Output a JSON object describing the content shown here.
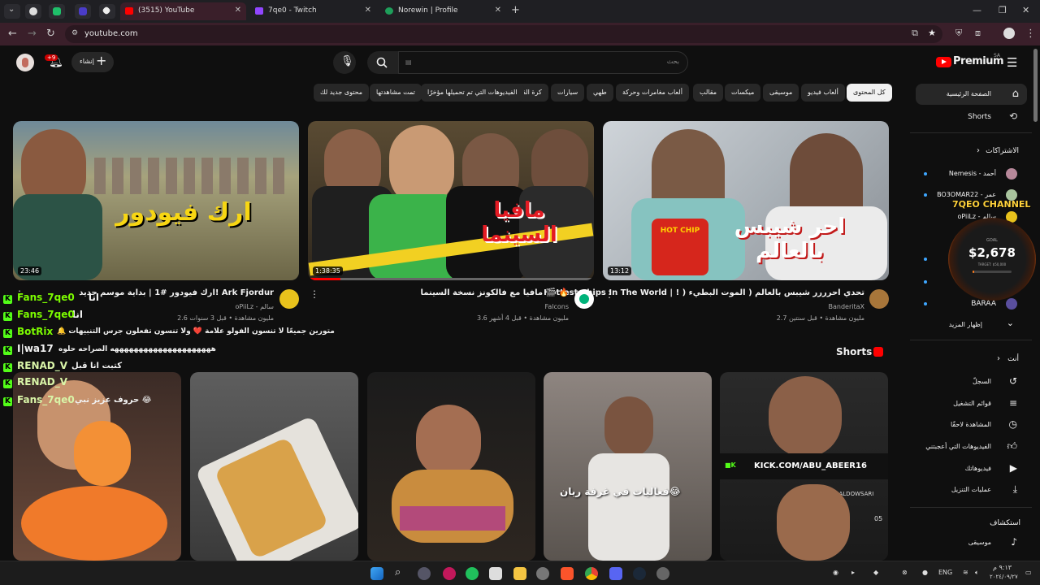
{
  "browser": {
    "tabs": [
      {
        "title": "(3515) YouTube",
        "color": "#ff0000"
      },
      {
        "title": "7qe0 - Twitch",
        "color": "#9146ff"
      },
      {
        "title": "Norewin | Profile",
        "color": "#1e9e5a"
      }
    ],
    "url": "youtube.com",
    "new_tab": "+"
  },
  "youtube": {
    "logo": "Premium",
    "region": "SA",
    "search_placeholder": "بحث",
    "create_label": "إنشاء",
    "notif_badge": "+9",
    "chips": [
      "كل المحتوى",
      "ألعاب فيديو",
      "موسيقى",
      "ميكسات",
      "مقالب",
      "ألعاب مغامرات وحركة",
      "طهي",
      "سيارات",
      "كرة القدم",
      "الفيديوهات التي تم تحميلها مؤخرًا",
      "تمت مشاهدتها",
      "محتوى جديد لك"
    ],
    "videos": [
      {
        "title": "Hottest Chips In The World | ! ) تحدي احرررر شيبس بالعالم ( الموت البطيء",
        "channel": "BanderitaX",
        "meta": "2.7 مليون مشاهدة • قبل سنتين",
        "duration": "13:12",
        "thumb_text": "احر شيبس بالعالم",
        "chip_text": "HOT CHIP"
      },
      {
        "title": "مافيا مع فالكونز نسخة السينما 🎬 🔥",
        "channel": "Falcons",
        "meta": "3.6 مليون مشاهدة • قبل 4 أشهر",
        "duration": "1:38:35",
        "thumb_text": "مافيا السينما"
      },
      {
        "title": "ارك فيودور #1 | بداية موسم جديد! Ark Fjordur",
        "channel": "oPiiLz - سالم",
        "meta": "2.6 مليون مشاهدة • قبل 3 سنوات",
        "duration": "23:46",
        "thumb_text": "ارك فيودور"
      }
    ],
    "shorts_title": "Shorts",
    "shorts": [
      {
        "caption": "",
        "overlay": ""
      },
      {
        "caption": "",
        "overlay": ""
      },
      {
        "caption": "",
        "overlay": ""
      },
      {
        "caption": "فعاليات في غرفة ريان😂",
        "overlay": ""
      },
      {
        "caption": "",
        "overlay": "KICK.COM/ABU_ABEER16",
        "name": "AHMAD ALDOWSARI",
        "num": "05"
      }
    ],
    "sidebar": {
      "home": "الصفحة الرئيسية",
      "shorts": "Shorts",
      "subs_title": "الاشتراكات",
      "subs": [
        "Nemesis - أحمد",
        "BO3OMAR22 - عمر",
        "oPiiLz - سالم",
        "",
        "",
        "BARAA"
      ],
      "show_more": "إظهار المزيد",
      "you_title": "أنت",
      "you_items": [
        "السجلّ",
        "قوائم التشغيل",
        "المشاهدة لاحقًا",
        "الفيديوهات التي أعجبتني",
        "فيديوهاتك",
        "عمليات التنزيل"
      ],
      "explore_title": "استكشاف",
      "explore_items": [
        "موسيقى"
      ]
    }
  },
  "overlay": {
    "channel_badge": "7QEO CHANNEL",
    "goal_label": "GOAL",
    "goal_amount": "$2,678",
    "goal_target": "TARGET: $50,000",
    "goal_fraction": 0.05,
    "chat": [
      {
        "user": "Fans_7qe0",
        "msg": "انا",
        "color": "#7CFC00"
      },
      {
        "user": "Fans_7qe0",
        "msg": "انا",
        "color": "#7CFC00"
      },
      {
        "user": "BotRix",
        "msg": "🔔 متورين جميعًا لا تنسون الفولو علامة ❤️ ولا تنسون تفعلون جرس التنبيهات",
        "color": "#7CFC00"
      },
      {
        "user": "I|wa17",
        "msg": "هههههههههههههههههههههه الصراحه حلوه",
        "color": "#ffffff"
      },
      {
        "user": "RENAD_V",
        "msg": "كتبت انا قبل",
        "color": "#d9f5a8"
      },
      {
        "user": "RENAD_V",
        "msg": "",
        "color": "#d9f5a8"
      },
      {
        "user": "Fans_7qe0",
        "msg": "حروف عزيز نبي 😂",
        "color": "#d9f5a8"
      }
    ]
  },
  "taskbar": {
    "lang": "ENG",
    "lang2": "ARA",
    "time": "٩:١٣ م",
    "date": "٢٠٢٤/٠٩/٢٧"
  },
  "colors": {
    "yt_red": "#ff0000",
    "kick_green": "#53fc18",
    "accent_blue": "#3ea6ff"
  }
}
